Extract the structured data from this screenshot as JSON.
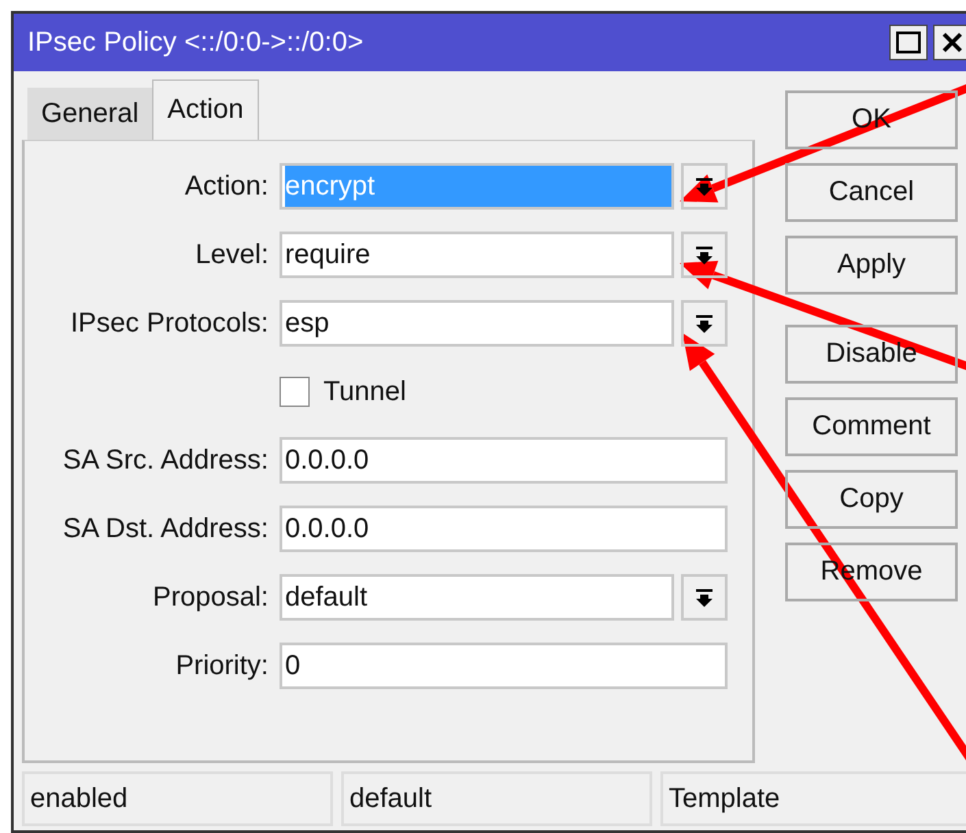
{
  "window": {
    "title": "IPsec Policy <::/0:0->::/0:0>"
  },
  "tabs": [
    {
      "label": "General",
      "selected": false
    },
    {
      "label": "Action",
      "selected": true
    }
  ],
  "fields": [
    {
      "kind": "dropdown",
      "label": "Action:",
      "value": "encrypt",
      "highlighted": true
    },
    {
      "kind": "dropdown",
      "label": "Level:",
      "value": "require",
      "highlighted": false
    },
    {
      "kind": "dropdown",
      "label": "IPsec Protocols:",
      "value": "esp",
      "highlighted": false
    },
    {
      "kind": "checkbox",
      "label": "Tunnel",
      "checked": false
    },
    {
      "kind": "text",
      "label": "SA Src. Address:",
      "value": "0.0.0.0",
      "highlighted": false
    },
    {
      "kind": "text",
      "label": "SA Dst. Address:",
      "value": "0.0.0.0",
      "highlighted": false
    },
    {
      "kind": "dropdown",
      "label": "Proposal:",
      "value": "default",
      "highlighted": false
    },
    {
      "kind": "text",
      "label": "Priority:",
      "value": "0",
      "highlighted": false
    }
  ],
  "buttons": [
    {
      "label": "OK",
      "group_start": false
    },
    {
      "label": "Cancel",
      "group_start": false
    },
    {
      "label": "Apply",
      "group_start": false
    },
    {
      "label": "Disable",
      "group_start": true
    },
    {
      "label": "Comment",
      "group_start": false
    },
    {
      "label": "Copy",
      "group_start": false
    },
    {
      "label": "Remove",
      "group_start": false
    }
  ],
  "status_bar": [
    "enabled",
    "default",
    "Template"
  ]
}
